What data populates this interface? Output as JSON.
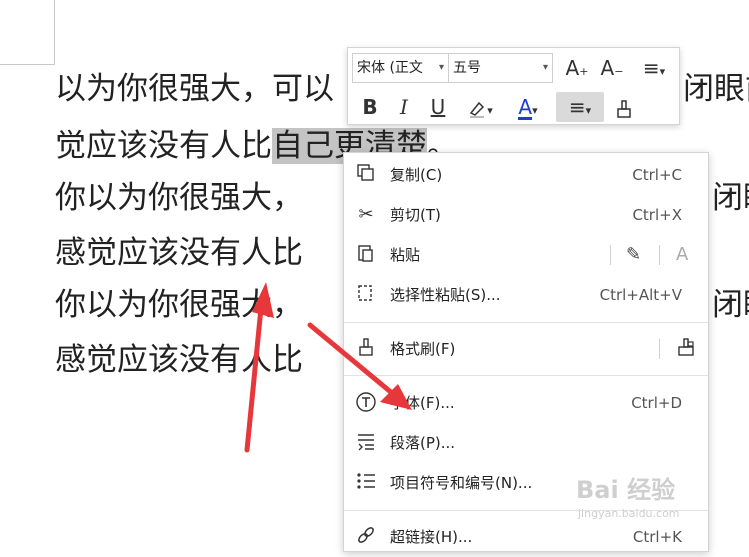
{
  "document": {
    "lines": [
      {
        "text": "以为你很强大，可以"
      },
      {
        "before": "觉应该没有人比",
        "selected": "自己更清楚",
        "after": "。"
      },
      {
        "text": "你以为你很强大，"
      },
      {
        "text": "感觉应该没有人比"
      },
      {
        "text": "你以为你很强大，"
      },
      {
        "text": "感觉应该没有人比"
      }
    ],
    "right_fragments": [
      "闭眼前",
      "闭眼",
      "闭眼"
    ]
  },
  "mini_toolbar": {
    "font_name": "宋体 (正文",
    "font_size": "五号",
    "increase_font": "A",
    "decrease_font": "A",
    "line_spacing": "≡",
    "bold": "B",
    "italic": "I",
    "underline": "U",
    "font_color": "A",
    "align": "≡"
  },
  "context_menu": {
    "items": [
      {
        "label": "复制(C)",
        "shortcut": "Ctrl+C",
        "icon": "copy-icon"
      },
      {
        "label": "剪切(T)",
        "shortcut": "Ctrl+X",
        "icon": "cut-icon"
      },
      {
        "label": "粘贴",
        "shortcut": "",
        "icon": "paste-icon"
      },
      {
        "label": "选择性粘贴(S)...",
        "shortcut": "Ctrl+Alt+V",
        "icon": "paste-special-icon"
      },
      {
        "label": "格式刷(F)",
        "shortcut": "",
        "icon": "format-painter-icon"
      },
      {
        "label": "字体(F)...",
        "shortcut": "Ctrl+D",
        "icon": "font-icon"
      },
      {
        "label": "段落(P)...",
        "shortcut": "",
        "icon": "paragraph-icon"
      },
      {
        "label": "项目符号和编号(N)...",
        "shortcut": "",
        "icon": "bullets-icon"
      },
      {
        "label": "超链接(H)...",
        "shortcut": "Ctrl+K",
        "icon": "hyperlink-icon"
      }
    ]
  },
  "watermark": {
    "brand": "Bai 经验",
    "url": "jingyan.baidu.com"
  },
  "colors": {
    "arrow": "#e8373a",
    "selection": "#c4c4c4",
    "font_color_underline": "#1f3bd6"
  }
}
